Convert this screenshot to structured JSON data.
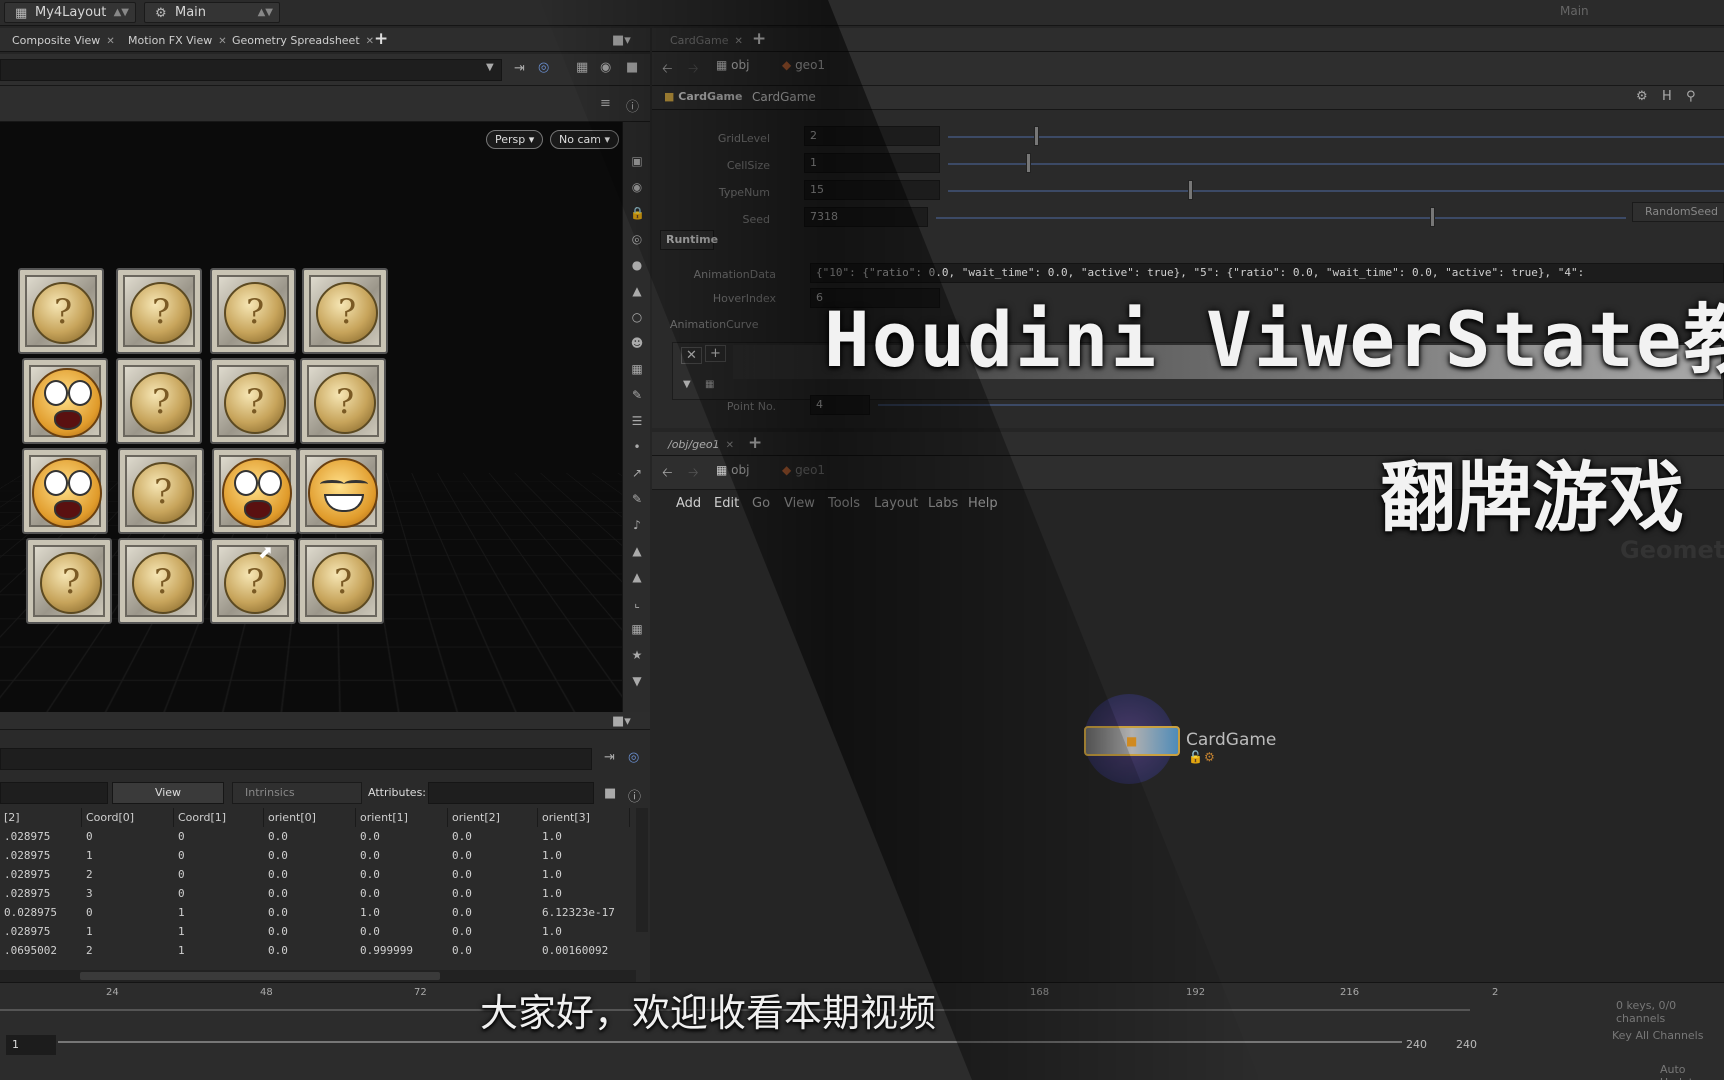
{
  "topbar": {
    "layout_label": "My4Layout",
    "desktop_label": "Main",
    "right_label": "Main"
  },
  "left_tabs": [
    "Composite View",
    "Motion FX View",
    "Geometry Spreadsheet"
  ],
  "viewport": {
    "persp": "Persp ▾",
    "cam": "No cam ▾"
  },
  "cards": [
    [
      "coin",
      "coin",
      "coin",
      "coin"
    ],
    [
      "scared",
      "coin",
      "coin",
      "coin"
    ],
    [
      "scared",
      "coin",
      "scared",
      "laugh"
    ],
    [
      "coin",
      "coin",
      "coin",
      "coin"
    ]
  ],
  "spreadsheet": {
    "view_label": "View",
    "intrinsics_label": "Intrinsics",
    "attributes_label": "Attributes:",
    "columns": [
      "[2]",
      "Coord[0]",
      "Coord[1]",
      "orient[0]",
      "orient[1]",
      "orient[2]",
      "orient[3]"
    ],
    "rows": [
      [
        ".028975",
        "0",
        "0",
        "0.0",
        "0.0",
        "0.0",
        "1.0"
      ],
      [
        ".028975",
        "1",
        "0",
        "0.0",
        "0.0",
        "0.0",
        "1.0"
      ],
      [
        ".028975",
        "2",
        "0",
        "0.0",
        "0.0",
        "0.0",
        "1.0"
      ],
      [
        ".028975",
        "3",
        "0",
        "0.0",
        "0.0",
        "0.0",
        "1.0"
      ],
      [
        "0.028975",
        "0",
        "1",
        "0.0",
        "1.0",
        "0.0",
        "6.12323e-17"
      ],
      [
        ".028975",
        "1",
        "1",
        "0.0",
        "0.0",
        "0.0",
        "1.0"
      ],
      [
        ".0695002",
        "2",
        "1",
        "0.0",
        "0.999999",
        "0.0",
        "0.00160092"
      ]
    ]
  },
  "param_pane": {
    "tab": "CardGame",
    "path_obj": "obj",
    "path_geo": "geo1",
    "node_type": "CardGame",
    "node_name": "CardGame",
    "parms": [
      {
        "label": "GridLevel",
        "value": "2"
      },
      {
        "label": "CellSize",
        "value": "1"
      },
      {
        "label": "TypeNum",
        "value": "15"
      },
      {
        "label": "Seed",
        "value": "7318"
      }
    ],
    "random_seed_label": "RandomSeed",
    "runtime_tab": "Runtime",
    "animation_data_label": "AnimationData",
    "animation_data_value": "{\"10\": {\"ratio\": 0.0, \"wait_time\": 0.0, \"active\": true}, \"5\": {\"ratio\": 0.0, \"wait_time\": 0.0, \"active\": true}, \"4\":",
    "hover_index_label": "HoverIndex",
    "hover_index_value": "6",
    "animation_curve_label": "AnimationCurve",
    "point_no_label": "Point No.",
    "point_no_value": "4"
  },
  "network": {
    "tab": "/obj/geo1",
    "path_obj": "obj",
    "path_geo": "geo1",
    "menus": [
      "Add",
      "Edit",
      "Go",
      "View",
      "Tools",
      "Layout",
      "Labs",
      "Help"
    ],
    "node_label": "CardGame",
    "watermark": "Geomet"
  },
  "overlay": {
    "title_line1": "Houdini ViwerState教程",
    "title_line2": "翻牌游戏",
    "subtitle": "大家好，欢迎收看本期视频"
  },
  "timeline": {
    "ticks": [
      "24",
      "48",
      "72",
      "168",
      "192",
      "216",
      "2"
    ],
    "current_frame": "1",
    "end_frame": "240",
    "end_frame2": "240",
    "keys_label": "0 keys, 0/0 channels",
    "key_all_label": "Key All Channels",
    "auto_update": "Auto Update"
  },
  "colors": {
    "accent": "#3c4a66",
    "bg": "#252525",
    "viewport": "#0b0b0b"
  }
}
